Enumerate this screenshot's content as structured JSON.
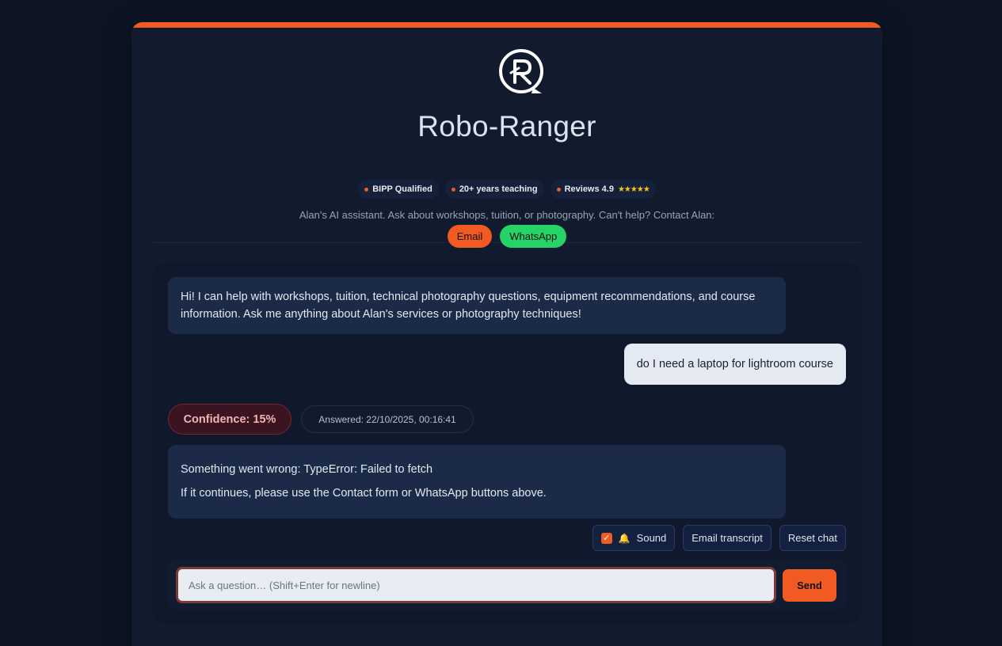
{
  "header": {
    "title": "Robo-Ranger",
    "badges": [
      {
        "label": "BIPP Qualified"
      },
      {
        "label": "20+ years teaching"
      },
      {
        "label": "Reviews 4.9",
        "stars": "★★★★★",
        "rating": 4.9
      }
    ],
    "subtitle": "Alan's AI assistant. Ask about workshops, tuition, or photography. Can't help? Contact Alan:",
    "contact": {
      "email_label": "Email",
      "whatsapp_label": "WhatsApp"
    }
  },
  "chat": {
    "greeting": "Hi! I can help with workshops, tuition, technical photography questions, equipment recommendations, and course information. Ask me anything about Alan's services or photography techniques!",
    "user_message": "do I need a laptop for lightroom course",
    "confidence": "Confidence: 15%",
    "answered": "Answered: 22/10/2025, 00:16:41",
    "error_line1": "Something went wrong: TypeError: Failed to fetch",
    "error_line2": "If it continues, please use the Contact form or WhatsApp buttons above."
  },
  "controls": {
    "sound_label": "Sound",
    "sound_checked": true,
    "email_transcript_label": "Email transcript",
    "reset_label": "Reset chat"
  },
  "composer": {
    "placeholder": "Ask a question… (Shift+Enter for newline)",
    "send_label": "Send"
  },
  "colors": {
    "accent": "#f15a22",
    "whatsapp": "#25d366",
    "background": "#0d1525",
    "card": "#111b2d"
  }
}
